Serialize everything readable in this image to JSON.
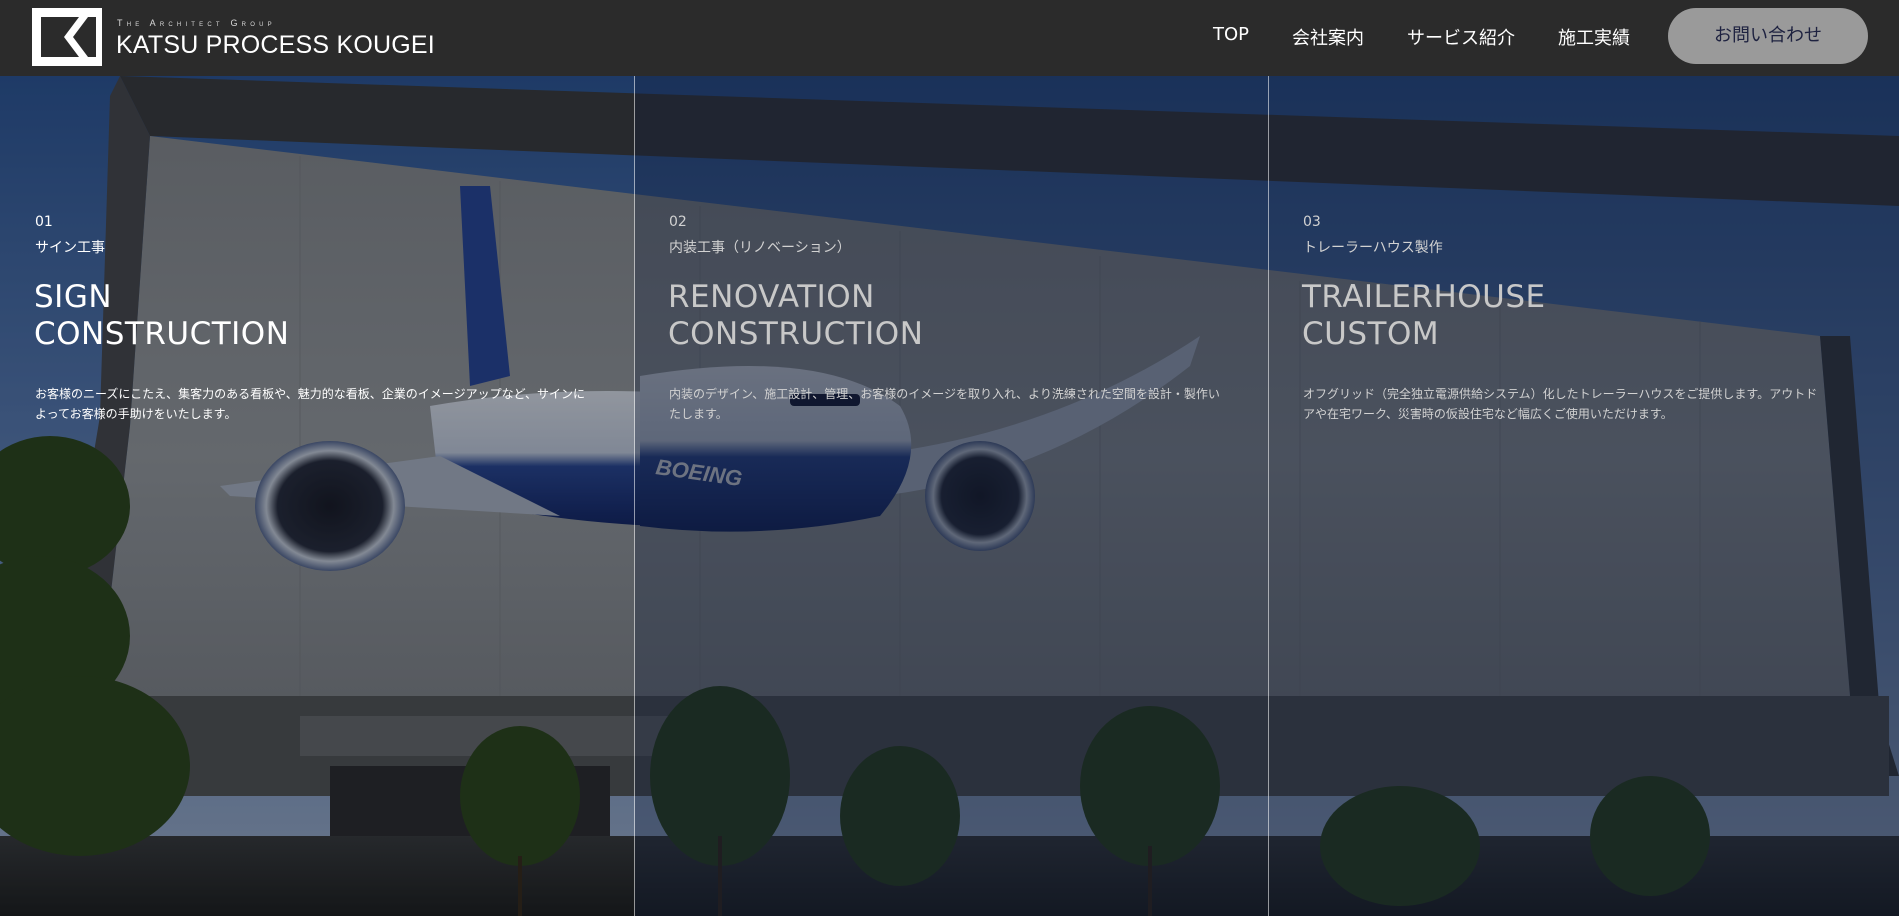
{
  "header": {
    "logo": {
      "tagline": "The Architect Group",
      "name": "KATSU PROCESS KOUGEI"
    },
    "nav": [
      {
        "label": "TOP"
      },
      {
        "label": "会社案内"
      },
      {
        "label": "サービス紹介"
      },
      {
        "label": "施工実績"
      }
    ],
    "contact_label": "お問い合わせ"
  },
  "services": [
    {
      "number": "01",
      "jp_title": "サイン工事",
      "title_line1": "SIGN",
      "title_line2": "CONSTRUCTION",
      "description": "お客様のニーズにこたえ、集客力のある看板や、魅力的な看板、企業のイメージアップなど、サインによってお客様の手助けをいたします。"
    },
    {
      "number": "02",
      "jp_title": "内装工事（リノベーション）",
      "title_line1": "RENOVATION",
      "title_line2": "CONSTRUCTION",
      "description": "内装のデザイン、施工設計、管理、お客様のイメージを取り入れ、より洗練された空間を設計・製作いたします。"
    },
    {
      "number": "03",
      "jp_title": "トレーラーハウス製作",
      "title_line1": "TRAILERHOUSE",
      "title_line2": "CUSTOM",
      "description": "オフグリッド（完全独立電源供給システム）化したトレーラーハウスをご提供します。アウトドアや在宅ワーク、災害時の仮設住宅など幅広くご使用いただけます。"
    }
  ],
  "colors": {
    "header_bg": "#2b2b2b",
    "contact_bg": "#9a9a9a",
    "contact_text": "#1e2240",
    "sky_top": "#2f5a9e",
    "plane_body": "#1e3a8a"
  }
}
